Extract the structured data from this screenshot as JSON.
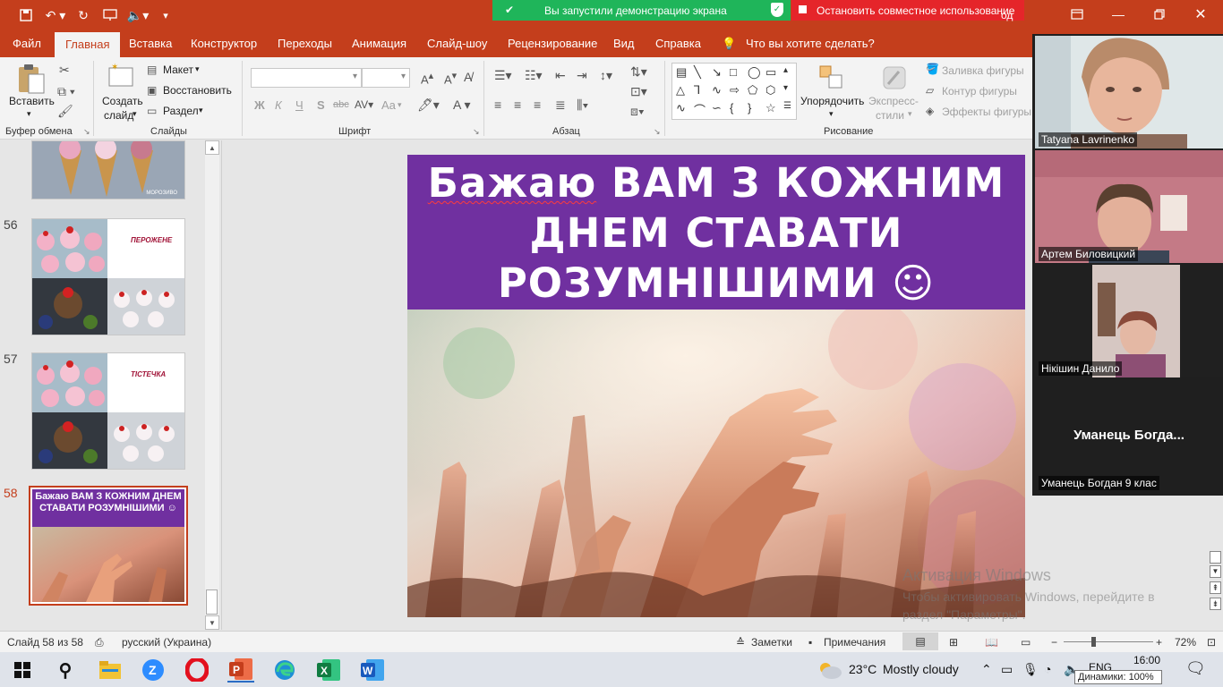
{
  "window": {
    "share_banner": "Вы запустили демонстрацию экрана",
    "stop_share": "Остановить совместное использование",
    "behind_text": "од"
  },
  "ribbon_tabs": [
    "Файл",
    "Главная",
    "Вставка",
    "Конструктор",
    "Переходы",
    "Анимация",
    "Слайд-шоу",
    "Рецензирование",
    "Вид",
    "Справка"
  ],
  "tell_me": "Что вы хотите сделать?",
  "ribbon": {
    "clipboard": {
      "paste": "Вставить",
      "label": "Буфер обмена"
    },
    "slides": {
      "new_slide_line1": "Создать",
      "new_slide_line2": "слайд",
      "layout": "Макет",
      "reset": "Восстановить",
      "section": "Раздел",
      "label": "Слайды"
    },
    "font": {
      "bold": "Ж",
      "italic": "К",
      "underline": "Ч",
      "shadow": "S",
      "strike": "abc",
      "case": "Aa",
      "label": "Шрифт"
    },
    "paragraph": {
      "label": "Абзац"
    },
    "drawing": {
      "arrange": "Упорядочить",
      "quick_styles_line1": "Экспресс-",
      "quick_styles_line2": "стили",
      "shape_fill": "Заливка фигуры",
      "shape_outline": "Контур фигуры",
      "shape_effects": "Эффекты фигуры",
      "label": "Рисование"
    }
  },
  "thumbnails": [
    {
      "number": "56",
      "caption": "ПЕРОЖЕНЕ"
    },
    {
      "number": "57",
      "caption": "ТІСТЕЧКА"
    },
    {
      "number": "58",
      "caption": "Бажаю ВАМ З КОЖНИМ ДНЕМ СТАВАТИ РОЗУМНІШИМИ ☺"
    }
  ],
  "thumb_top_caption": "МОРОЗИВО",
  "slide": {
    "title_word1": "Бажаю",
    "title_rest": " ВАМ З КОЖНИМ ДНЕМ СТАВАТИ РОЗУМНІШИМИ ☺"
  },
  "participants": [
    {
      "name": "Tatyana Lavrinenko"
    },
    {
      "name": "Артем Биловицкий"
    },
    {
      "name": "Нікішин Данило"
    },
    {
      "name": "Уманець Богдан 9 клас",
      "display": "Уманець  Богда..."
    }
  ],
  "watermark": {
    "title": "Активация Windows",
    "body": "Чтобы активировать Windows, перейдите в раздел \"Параметры\"."
  },
  "status": {
    "slide_counter": "Слайд 58 из 58",
    "language": "русский (Украина)",
    "notes": "Заметки",
    "comments": "Примечания",
    "zoom": "72%"
  },
  "taskbar": {
    "weather_temp": "23°C",
    "weather_desc": "Mostly cloudy",
    "lang": "ENG",
    "time": "16:00",
    "tooltip": "Динамики: 100%"
  },
  "colors": {
    "accent": "#c43e1c",
    "slide_purple": "#7030a0",
    "share_green": "#1fb55a",
    "stop_red": "#e5252a"
  }
}
